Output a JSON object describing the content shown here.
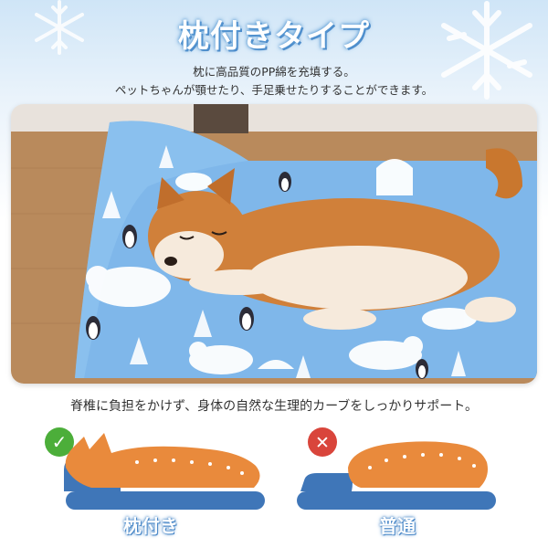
{
  "title": "枕付きタイプ",
  "subtitle_line1": "枕に高品質のPP綿を充填する。",
  "subtitle_line2": "ペットちゃんが顎せたり、手足乗せたりすることができます。",
  "description": "脊椎に負担をかけず、身体の自然な生理的カーブをしっかりサポート。",
  "comparison": {
    "good_label": "枕付き",
    "bad_label": "普通",
    "good_mark": "✓",
    "bad_mark": "✕"
  },
  "colors": {
    "accent_blue": "#3f76b8",
    "dog_orange": "#e98a3c",
    "check_green": "#4cae3a",
    "cross_red": "#d9453b",
    "mat_blue": "#7fb7ea"
  }
}
